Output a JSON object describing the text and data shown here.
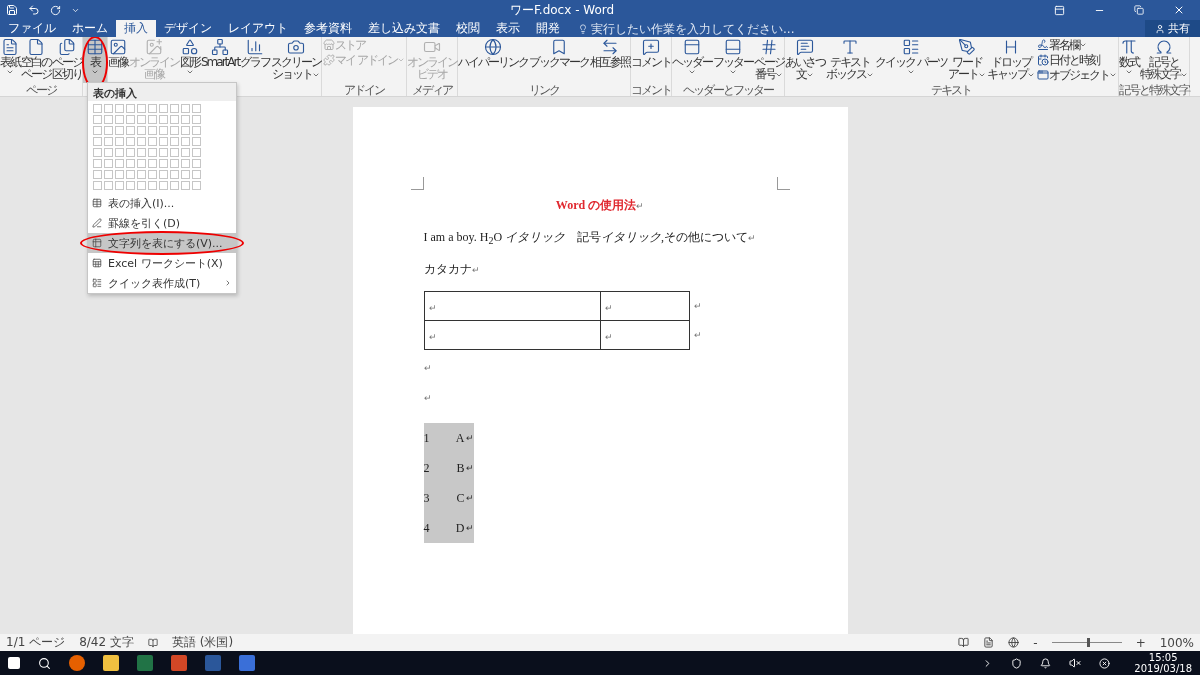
{
  "window": {
    "title": "ワーF.docx - Word"
  },
  "tabs": [
    {
      "label": "ファイル",
      "selected": false
    },
    {
      "label": "ホーム",
      "selected": false
    },
    {
      "label": "挿入",
      "selected": true
    },
    {
      "label": "デザイン",
      "selected": false
    },
    {
      "label": "レイアウト",
      "selected": false
    },
    {
      "label": "参考資料",
      "selected": false
    },
    {
      "label": "差し込み文書",
      "selected": false
    },
    {
      "label": "校閲",
      "selected": false
    },
    {
      "label": "表示",
      "selected": false
    },
    {
      "label": "開発",
      "selected": false
    }
  ],
  "tell_me": {
    "placeholder": "実行したい作業を入力してください..."
  },
  "share": {
    "label": "共有"
  },
  "ribbon_groups": [
    {
      "label": "ページ",
      "buttons": [
        {
          "kind": "large",
          "lines": [
            "表紙"
          ],
          "dropdown": true,
          "disabled": false,
          "pressed": false
        },
        {
          "kind": "large",
          "lines": [
            "空白の",
            "ページ"
          ],
          "dropdown": false,
          "disabled": false,
          "pressed": false
        },
        {
          "kind": "large",
          "lines": [
            "ページ",
            "区切り"
          ],
          "dropdown": false,
          "disabled": false,
          "pressed": false
        }
      ]
    },
    {
      "buttons": [
        {
          "kind": "large",
          "lines": [
            "表"
          ],
          "dropdown": true,
          "disabled": false,
          "pressed": true
        }
      ]
    },
    {
      "buttons": [
        {
          "kind": "large",
          "lines": [
            "画像"
          ],
          "dropdown": false,
          "disabled": false,
          "pressed": false
        },
        {
          "kind": "large",
          "lines": [
            "オンライン",
            "画像"
          ],
          "dropdown": false,
          "disabled": true,
          "pressed": false
        },
        {
          "kind": "large",
          "lines": [
            "図形"
          ],
          "dropdown": true,
          "disabled": false,
          "pressed": false
        },
        {
          "kind": "large",
          "lines": [
            "SmartArt"
          ],
          "dropdown": false,
          "disabled": false,
          "pressed": false
        },
        {
          "kind": "large",
          "lines": [
            "グラフ"
          ],
          "dropdown": false,
          "disabled": false,
          "pressed": false
        },
        {
          "kind": "large",
          "lines": [
            "スクリーン",
            "ショット"
          ],
          "dropdown": true,
          "disabled": false,
          "pressed": false
        }
      ]
    },
    {
      "label": "アドイン",
      "buttons": [
        {
          "kind": "small",
          "lines": [
            "ストア"
          ],
          "dropdown": false,
          "disabled": true,
          "pressed": false
        },
        {
          "kind": "small",
          "lines": [
            "マイ アドイン"
          ],
          "dropdown": true,
          "disabled": true,
          "pressed": false
        }
      ]
    },
    {
      "label": "メディア",
      "buttons": [
        {
          "kind": "large",
          "lines": [
            "オンライン",
            "ビデオ"
          ],
          "dropdown": false,
          "disabled": true,
          "pressed": false
        }
      ]
    },
    {
      "label": "リンク",
      "buttons": [
        {
          "kind": "large",
          "lines": [
            "ハイパーリンク"
          ],
          "dropdown": false,
          "disabled": false,
          "pressed": false
        },
        {
          "kind": "large",
          "lines": [
            "ブックマーク"
          ],
          "dropdown": false,
          "disabled": false,
          "pressed": false
        },
        {
          "kind": "large",
          "lines": [
            "相互参照"
          ],
          "dropdown": false,
          "disabled": false,
          "pressed": false
        }
      ]
    },
    {
      "label": "コメント",
      "buttons": [
        {
          "kind": "large",
          "lines": [
            "コメント"
          ],
          "dropdown": false,
          "disabled": false,
          "pressed": false
        }
      ]
    },
    {
      "label": "ヘッダーとフッター",
      "buttons": [
        {
          "kind": "large",
          "lines": [
            "ヘッダー"
          ],
          "dropdown": true,
          "disabled": false,
          "pressed": false
        },
        {
          "kind": "large",
          "lines": [
            "フッター"
          ],
          "dropdown": true,
          "disabled": false,
          "pressed": false
        },
        {
          "kind": "large",
          "lines": [
            "ページ",
            "番号"
          ],
          "dropdown": true,
          "disabled": false,
          "pressed": false
        }
      ]
    },
    {
      "label": "テキスト",
      "buttons": [
        {
          "kind": "large",
          "lines": [
            "あいさつ",
            "文"
          ],
          "dropdown": true,
          "disabled": false,
          "pressed": false
        },
        {
          "kind": "large",
          "lines": [
            "テキスト",
            "ボックス"
          ],
          "dropdown": true,
          "disabled": false,
          "pressed": false
        },
        {
          "kind": "large",
          "lines": [
            "クイック パーツ"
          ],
          "dropdown": true,
          "disabled": false,
          "pressed": false
        },
        {
          "kind": "large",
          "lines": [
            "ワード",
            "アート"
          ],
          "dropdown": true,
          "disabled": false,
          "pressed": false
        },
        {
          "kind": "large",
          "lines": [
            "ドロップ",
            "キャップ"
          ],
          "dropdown": true,
          "disabled": false,
          "pressed": false
        },
        {
          "kind": "small",
          "lines": [
            "署名欄"
          ],
          "dropdown": true,
          "disabled": false,
          "pressed": false
        },
        {
          "kind": "small",
          "lines": [
            "日付と時刻"
          ],
          "dropdown": false,
          "disabled": false,
          "pressed": false
        },
        {
          "kind": "small",
          "lines": [
            "オブジェクト"
          ],
          "dropdown": true,
          "disabled": false,
          "pressed": false
        }
      ]
    },
    {
      "label": "記号と特殊文字",
      "buttons": [
        {
          "kind": "large",
          "lines": [
            "数式"
          ],
          "dropdown": true,
          "disabled": false,
          "pressed": false
        },
        {
          "kind": "large",
          "lines": [
            "記号と",
            "特殊文字"
          ],
          "dropdown": true,
          "disabled": false,
          "pressed": false
        }
      ]
    }
  ],
  "table_menu": {
    "title": "表の挿入",
    "items": [
      {
        "label": "表の挿入(I)...",
        "selected": false,
        "submenu": false
      },
      {
        "label": "罫線を引く(D)",
        "selected": false,
        "submenu": false
      },
      {
        "label": "文字列を表にする(V)...",
        "selected": true,
        "submenu": false
      },
      {
        "label": "Excel ワークシート(X)",
        "selected": false,
        "submenu": false
      },
      {
        "label": "クイック表作成(T)",
        "selected": false,
        "submenu": true
      }
    ]
  },
  "document": {
    "heading": {
      "text": "Word の使用法",
      "mark": "↵"
    },
    "paragraphs": [
      {
        "runs": [
          {
            "text": "I am a boy. H$_{2}$O ",
            "italic": false
          },
          {
            "text": "イタリック",
            "italic": true
          },
          {
            "text": "　記号",
            "italic": false
          },
          {
            "text": "イタリック",
            "italic": true
          },
          {
            "text": ",その他について",
            "italic": false
          }
        ],
        "mark": "↵"
      },
      {
        "runs": [
          {
            "text": "カタカナ",
            "italic": false
          }
        ],
        "mark": "↵"
      }
    ],
    "table": {
      "rows": [
        {
          "cells": [
            "↵",
            "↵"
          ],
          "end_mark": "↵"
        },
        {
          "cells": [
            "↵",
            "↵"
          ],
          "end_mark": "↵"
        }
      ]
    },
    "empty_paragraphs": [
      "↵",
      "↵"
    ],
    "list": [
      {
        "number": "1",
        "text": "A",
        "mark": "↵",
        "selected": true
      },
      {
        "number": "2",
        "text": "B",
        "mark": "↵",
        "selected": true
      },
      {
        "number": "3",
        "text": "C",
        "mark": "↵",
        "selected": true
      },
      {
        "number": "4",
        "text": "D",
        "mark": "↵",
        "selected": true
      }
    ]
  },
  "status_bar": {
    "page": "1/1 ページ",
    "words": "8/42 文字",
    "language": "英語 (米国)",
    "zoom_minus": "-",
    "zoom_plus": "+",
    "zoom": "100%",
    "level": 0.5
  },
  "taskbar": {
    "time": "15:05",
    "date": "2019/03/18"
  }
}
